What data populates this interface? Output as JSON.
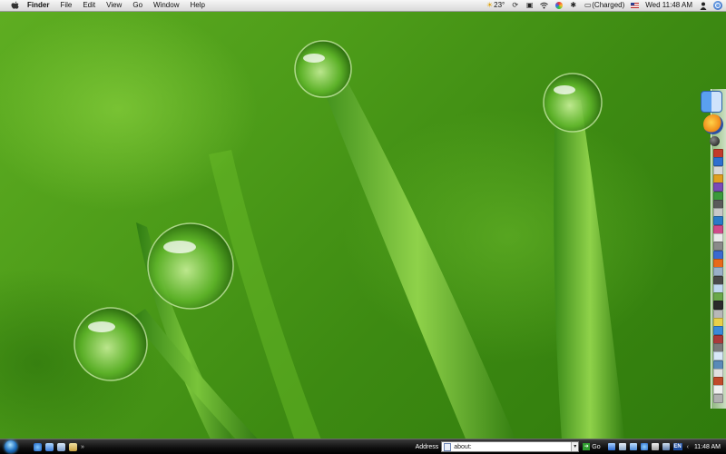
{
  "menubar": {
    "app_name": "Finder",
    "menus": [
      "File",
      "Edit",
      "View",
      "Go",
      "Window",
      "Help"
    ],
    "weather_temp": "23°",
    "battery_status": "(Charged)",
    "clock": "Wed 11:48 AM"
  },
  "taskbar": {
    "address_label": "Address",
    "address_value": "about:",
    "go_label": "Go",
    "language": "EN",
    "clock": "11:48 AM",
    "quicklaunch_more": "»"
  },
  "dock": {
    "mini_icon_colors": [
      "#c23b2a",
      "#2e6fcf",
      "#d8d8d8",
      "#e0a020",
      "#7a4ab8",
      "#3a9a3a",
      "#5a5a5a",
      "#c8c8c8",
      "#2a7ac8",
      "#d04a8a",
      "#eaeaea",
      "#8a8a8a",
      "#3a6ad0",
      "#e86a1a",
      "#9ab0c8",
      "#4a4a4a",
      "#c0d8f0",
      "#6aa84a",
      "#2a2a2a",
      "#b8b8b8",
      "#e8d04a",
      "#3a8ad8",
      "#aa3a3a",
      "#7a7a7a",
      "#d8e8f8",
      "#5a8ab8",
      "#e0e0e0",
      "#c04a2a",
      "#f0f0f0",
      "#b0b0b0"
    ]
  }
}
